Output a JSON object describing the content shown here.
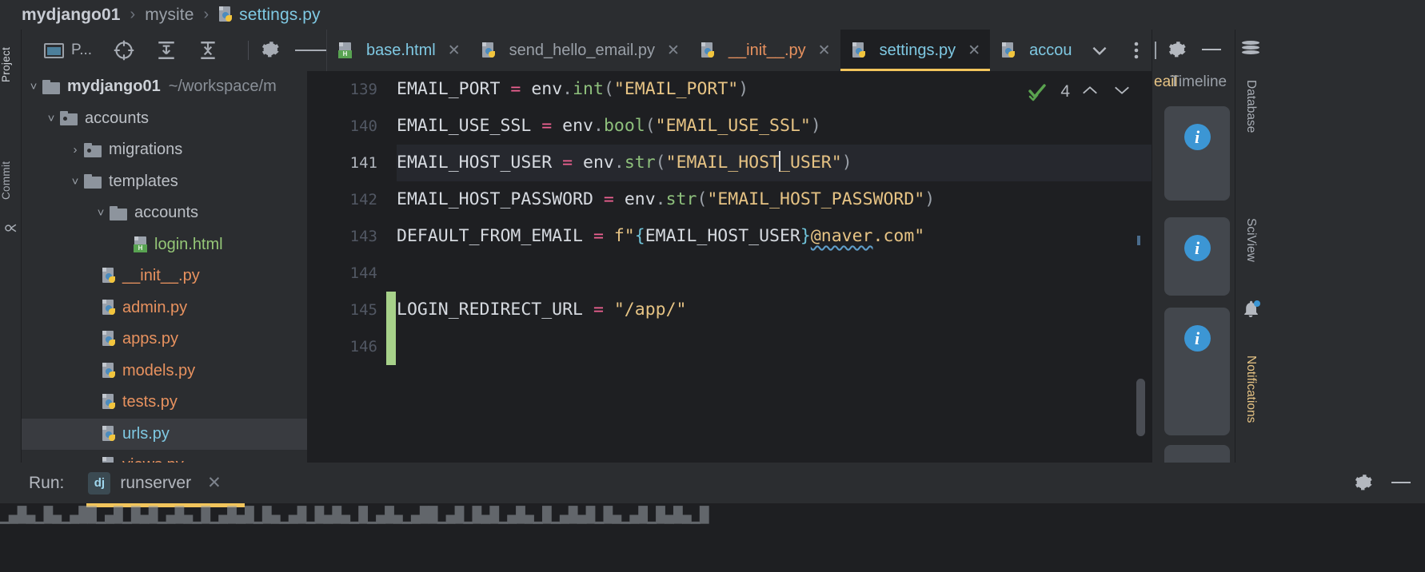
{
  "breadcrumb": {
    "items": [
      {
        "label": "mydjango01",
        "style": "bold"
      },
      {
        "label": "mysite",
        "style": "dim"
      },
      {
        "label": "settings.py",
        "style": "file",
        "icon": "python-file-icon"
      }
    ],
    "separator": "›"
  },
  "left_strip": {
    "tabs": [
      {
        "label": "Project",
        "active": true
      },
      {
        "label": "Commit",
        "active": false
      }
    ]
  },
  "project_panel": {
    "header": {
      "title": "P...",
      "icons": [
        "window-icon",
        "locate-target-icon",
        "expand-all-icon",
        "collapse-all-icon",
        "gear-icon",
        "minimize-icon"
      ]
    },
    "tree": [
      {
        "name": "mydjango01",
        "path": "~/workspace/m",
        "kind": "root",
        "indent": 0,
        "twist": "˅"
      },
      {
        "name": "accounts",
        "kind": "module-folder",
        "indent": 1,
        "twist": "˅"
      },
      {
        "name": "migrations",
        "kind": "module-folder",
        "indent": 2,
        "twist": "›"
      },
      {
        "name": "templates",
        "kind": "folder",
        "indent": 2,
        "twist": "˅"
      },
      {
        "name": "accounts",
        "kind": "folder",
        "indent": 3,
        "twist": "˅"
      },
      {
        "name": "login.html",
        "kind": "html",
        "indent": 4,
        "twist": ""
      },
      {
        "name": "__init__.py",
        "kind": "python",
        "indent": 2,
        "twist": ""
      },
      {
        "name": "admin.py",
        "kind": "python",
        "indent": 2,
        "twist": ""
      },
      {
        "name": "apps.py",
        "kind": "python",
        "indent": 2,
        "twist": ""
      },
      {
        "name": "models.py",
        "kind": "python",
        "indent": 2,
        "twist": ""
      },
      {
        "name": "tests.py",
        "kind": "python",
        "indent": 2,
        "twist": ""
      },
      {
        "name": "urls.py",
        "kind": "python",
        "indent": 2,
        "twist": "",
        "selected": true
      },
      {
        "name": "views.py",
        "kind": "python",
        "indent": 2,
        "twist": ""
      }
    ]
  },
  "editor": {
    "tabs": [
      {
        "label": "base.html",
        "type": "html",
        "active": false,
        "closable": true
      },
      {
        "label": "send_hello_email.py",
        "type": "python-dim",
        "active": false,
        "closable": true
      },
      {
        "label": "__init__.py",
        "type": "python",
        "active": false,
        "closable": true
      },
      {
        "label": "settings.py",
        "type": "python-active",
        "active": true,
        "closable": true
      },
      {
        "label": "accou",
        "type": "python-active",
        "active": false,
        "closable": false
      }
    ],
    "tab_overflow_icon": "chevron-down-icon",
    "tab_options_icon": "more-vertical-icon",
    "toolbar_icons": [
      "gear-icon",
      "minimize-icon"
    ],
    "inspection": {
      "icon": "inspection-ok-icon",
      "count": "4",
      "prev_icon": "chevron-up-icon",
      "next_icon": "chevron-down-icon"
    },
    "lines": [
      {
        "no": "139",
        "active": false,
        "vcs": false
      },
      {
        "no": "140",
        "active": false,
        "vcs": false
      },
      {
        "no": "141",
        "active": true,
        "vcs": false
      },
      {
        "no": "142",
        "active": false,
        "vcs": false
      },
      {
        "no": "143",
        "active": false,
        "vcs": false
      },
      {
        "no": "144",
        "active": false,
        "vcs": false
      },
      {
        "no": "145",
        "active": false,
        "vcs": true
      },
      {
        "no": "146",
        "active": false,
        "vcs": true
      }
    ],
    "code": {
      "l139": "EMAIL_PORT = env.int(\"EMAIL_PORT\")",
      "l140": "EMAIL_USE_SSL = env.bool(\"EMAIL_USE_SSL\")",
      "l141": "EMAIL_HOST_USER = env.str(\"EMAIL_HOST_USER\")",
      "l142": "EMAIL_HOST_PASSWORD = env.str(\"EMAIL_HOST_PASSWORD\")",
      "l143": "DEFAULT_FROM_EMAIL = f\"{EMAIL_HOST_USER}@naver.com\"",
      "l144": "",
      "l145": "LOGIN_REDIRECT_URL = \"/app/\"",
      "l146": ""
    }
  },
  "right_panel": {
    "title_back": "eail",
    "title_front": "Timeline",
    "notifications": [
      {
        "icon": "info-icon"
      },
      {
        "icon": "info-icon"
      },
      {
        "icon": "info-icon"
      },
      {
        "icon": "info-icon"
      }
    ]
  },
  "right_strip": {
    "tabs": [
      {
        "label": "Database",
        "icon": "database-icon",
        "active": false
      },
      {
        "label": "SciView",
        "icon": "grid-icon",
        "active": false
      },
      {
        "label": "Notifications",
        "icon": "bell-icon",
        "active": true,
        "badge": true
      }
    ]
  },
  "run_bar": {
    "label": "Run:",
    "config_icon": "django-icon",
    "config_icon_label": "dj",
    "config_name": "runserver",
    "close_icon": "close-icon",
    "gear_icon": "gear-icon",
    "minimize_icon": "minimize-icon"
  },
  "console": {
    "line": "▁▄█▄▁█▄▁▄██▁▄█▁█▄█▁▄█▄▁█▁▄█▄█▁█▄▁▄█▁█▄█▄▁█▁▄█▄▁▄██▁▄█▁█▄█▁▄█▄▁█▁▄█▄█▁█▄▁▄█▁█▄█▄▁█"
  },
  "colors": {
    "accent_yellow": "#f2c55c",
    "info_blue": "#3c96d4",
    "vcs_green": "#a7d18a",
    "python_orange": "#e8925f",
    "html_green": "#95c777",
    "cyan": "#7fc9e3"
  }
}
